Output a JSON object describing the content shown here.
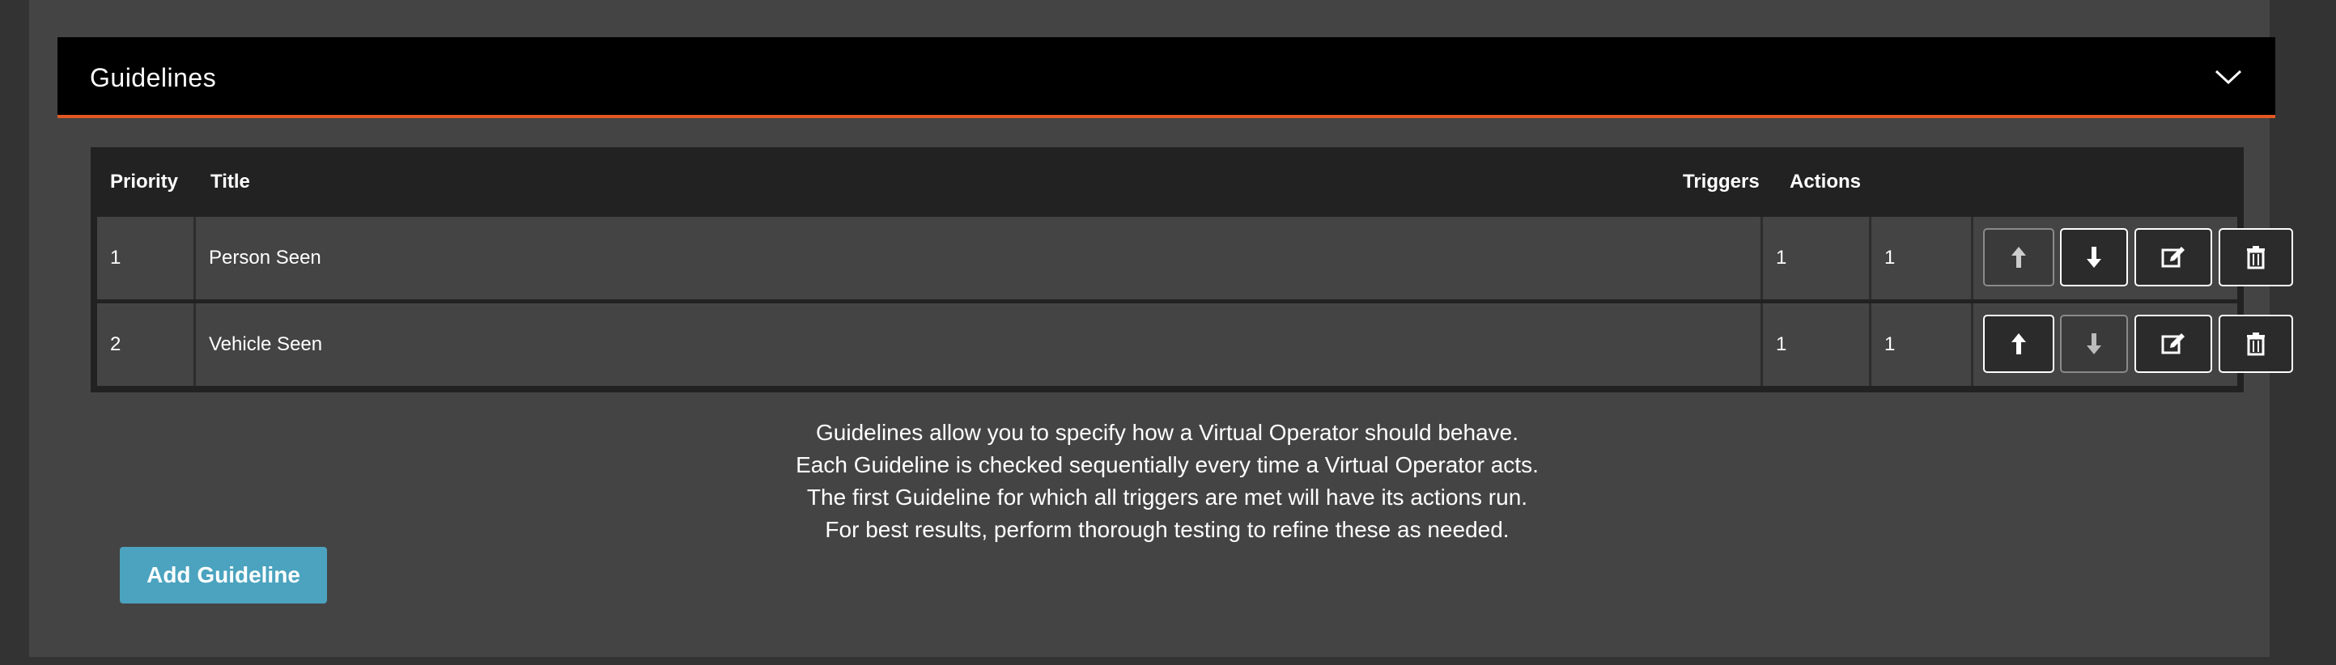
{
  "panel": {
    "title": "Guidelines",
    "collapse_icon": "chevron-down-icon",
    "accent_color": "#e25822"
  },
  "table": {
    "headers": {
      "priority": "Priority",
      "title": "Title",
      "triggers": "Triggers",
      "actions": "Actions"
    },
    "rows": [
      {
        "priority": "1",
        "title": "Person Seen",
        "triggers": "1",
        "actions": "1",
        "move_up_disabled": true,
        "move_down_disabled": false
      },
      {
        "priority": "2",
        "title": "Vehicle Seen",
        "triggers": "1",
        "actions": "1",
        "move_up_disabled": false,
        "move_down_disabled": true
      }
    ],
    "row_buttons": [
      "arrow-up-icon",
      "arrow-down-icon",
      "edit-icon",
      "trash-icon"
    ]
  },
  "info": {
    "lines": [
      "Guidelines allow you to specify how a Virtual Operator should behave.",
      "Each Guideline is checked sequentially every time a Virtual Operator acts.",
      "The first Guideline for which all triggers are met will have its actions run.",
      "For best results, perform thorough testing to refine these as needed."
    ]
  },
  "add_button": {
    "label": "Add Guideline",
    "color": "#4ba3bf"
  }
}
